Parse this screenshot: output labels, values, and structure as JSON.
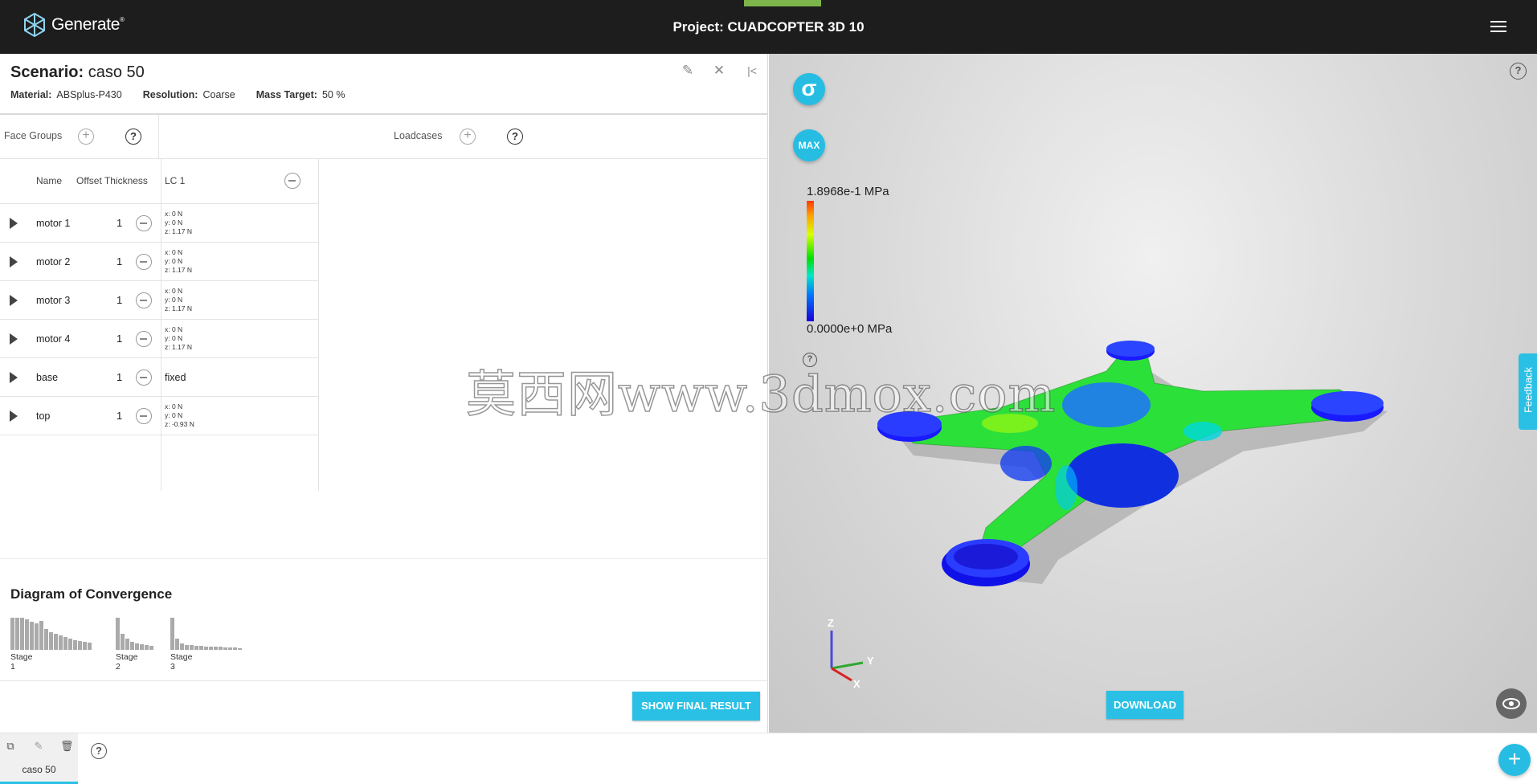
{
  "header": {
    "app_name": "Generate",
    "trademark": "®",
    "project_title": "Project: CUADCOPTER 3D 10"
  },
  "scenario": {
    "title_prefix": "Scenario:",
    "title_name": "caso 50",
    "material_label": "Material:",
    "material_value": "ABSplus-P430",
    "resolution_label": "Resolution:",
    "resolution_value": "Coarse",
    "mass_label": "Mass Target:",
    "mass_value": "50 %"
  },
  "face_groups": {
    "label": "Face Groups",
    "loadcases_label": "Loadcases"
  },
  "table": {
    "headers": {
      "name": "Name",
      "offset": "Offset Thickness",
      "lc": "LC 1"
    },
    "rows": [
      {
        "name": "motor 1",
        "offset": "1",
        "lx": "x: 0 N",
        "ly": "y: 0 N",
        "lz": "z: 1.17 N"
      },
      {
        "name": "motor 2",
        "offset": "1",
        "lx": "x: 0 N",
        "ly": "y: 0 N",
        "lz": "z: 1.17 N"
      },
      {
        "name": "motor 3",
        "offset": "1",
        "lx": "x: 0 N",
        "ly": "y: 0 N",
        "lz": "z: 1.17 N"
      },
      {
        "name": "motor 4",
        "offset": "1",
        "lx": "x: 0 N",
        "ly": "y: 0 N",
        "lz": "z: 1.17 N"
      },
      {
        "name": "base",
        "offset": "1",
        "fixed": "fixed"
      },
      {
        "name": "top",
        "offset": "1",
        "lx": "x: 0 N",
        "ly": "y: 0 N",
        "lz": "z: -0.93 N"
      }
    ]
  },
  "convergence": {
    "title": "Diagram of Convergence",
    "stages": [
      {
        "label": "Stage 1",
        "values": [
          1.0,
          1.0,
          1.0,
          0.95,
          0.88,
          0.82,
          0.9,
          0.65,
          0.55,
          0.5,
          0.45,
          0.4,
          0.35,
          0.3,
          0.28,
          0.25,
          0.22
        ]
      },
      {
        "label": "Stage 2",
        "values": [
          1.0,
          0.5,
          0.35,
          0.25,
          0.2,
          0.17,
          0.15,
          0.12
        ]
      },
      {
        "label": "Stage 3",
        "values": [
          1.0,
          0.35,
          0.2,
          0.16,
          0.14,
          0.13,
          0.12,
          0.11,
          0.1,
          0.1,
          0.09,
          0.08,
          0.07,
          0.07,
          0.06
        ]
      }
    ]
  },
  "actions": {
    "show_final": "SHOW FINAL RESULT",
    "download": "DOWNLOAD",
    "feedback": "Feedback"
  },
  "viewer": {
    "sigma_label": "σ",
    "max_label": "MAX",
    "legend_max": "1.8968e-1 MPa",
    "legend_min": "0.0000e+0 MPa",
    "axis_z": "Z",
    "axis_y": "Y",
    "axis_x": "X",
    "watermark": "莫西网www.3dmox.com"
  },
  "tabs": {
    "scenario_tab": "caso 50"
  },
  "colors": {
    "accent": "#2ac0e5",
    "topbar": "#1d1d1d",
    "brand_green": "#7db54a"
  }
}
